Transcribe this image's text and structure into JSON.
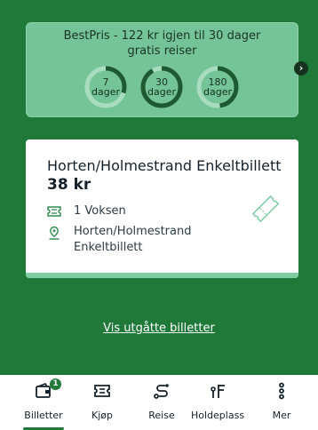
{
  "best_price": {
    "title": "BestPris - 122 kr igjen til 30 dager gratis reiser",
    "rings": [
      {
        "days": "7",
        "unit": "dager",
        "progress": 0.3
      },
      {
        "days": "30",
        "unit": "dager",
        "progress": 0.92
      },
      {
        "days": "180",
        "unit": "dager",
        "progress": 0.48
      }
    ],
    "next_icon": "chevron-right-icon"
  },
  "ticket": {
    "title": "Horten/Holmestrand Enkeltbillett",
    "price": "38 kr",
    "passenger": "1 Voksen",
    "zone_line1": "Horten/Holmestrand",
    "zone_line2": "Enkeltbillett"
  },
  "expired_link": "Vis utgåtte billetter",
  "nav": {
    "items": [
      {
        "label": "Billetter",
        "icon": "wallet-icon",
        "badge": "1",
        "active": true
      },
      {
        "label": "Kjøp",
        "icon": "ticket-icon",
        "active": false
      },
      {
        "label": "Reise",
        "icon": "route-icon",
        "active": false
      },
      {
        "label": "Holdeplass",
        "icon": "stop-icon",
        "active": false
      },
      {
        "label": "Mer",
        "icon": "more-icon",
        "active": false
      }
    ]
  },
  "colors": {
    "background": "#1f7a3a",
    "best_card": "#75c497",
    "ring_track": "#a7dcbf",
    "ring_fill": "#1d5a30"
  }
}
